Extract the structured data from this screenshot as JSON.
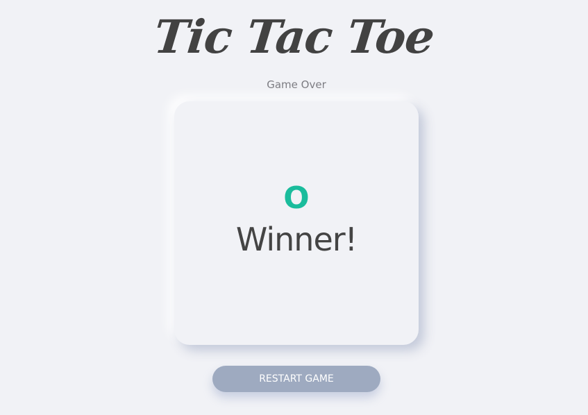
{
  "header": {
    "title": "Tic Tac Toe",
    "status": "Game Over"
  },
  "board": {
    "winner_mark": "O",
    "winner_text": "Winner!"
  },
  "actions": {
    "restart_label": "RESTART GAME"
  },
  "colors": {
    "background": "#f1f2f6",
    "title": "#424242",
    "winner_mark": "#1abc9c",
    "button": "#9eaac0"
  }
}
